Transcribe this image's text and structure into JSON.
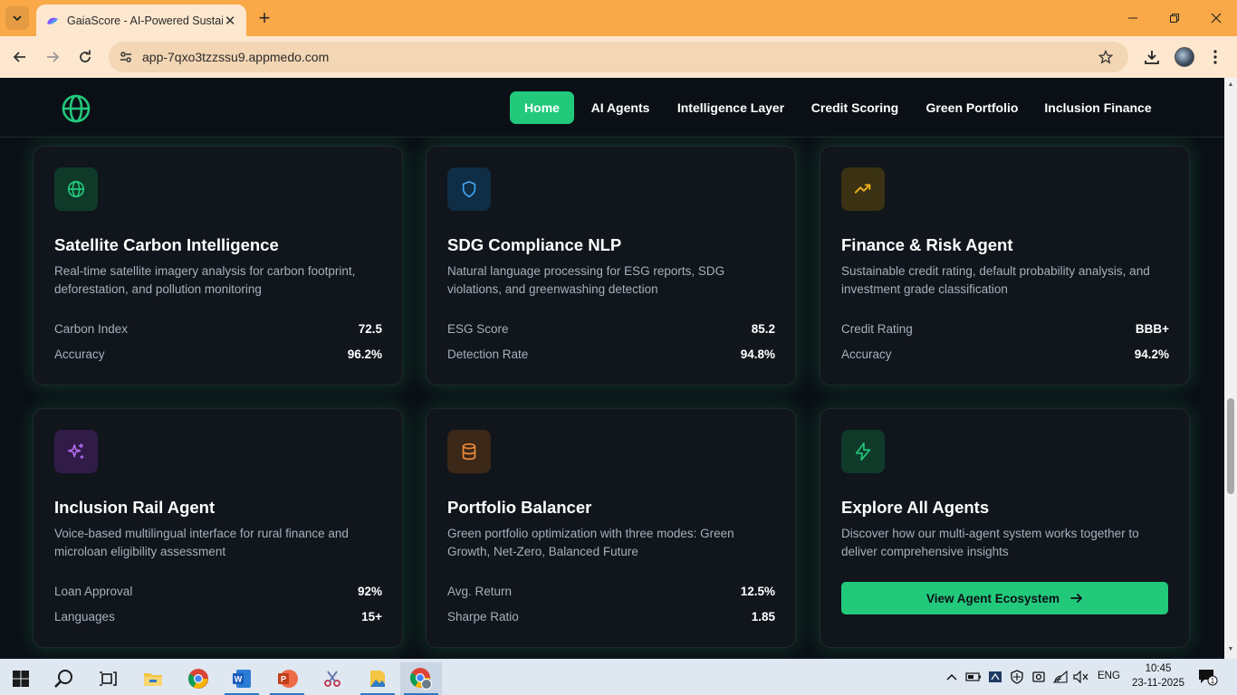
{
  "browser": {
    "tab_title": "GaiaScore - AI-Powered Sustain",
    "url": "app-7qxo3tzzssu9.appmedo.com"
  },
  "nav": {
    "items": [
      "Home",
      "AI Agents",
      "Intelligence Layer",
      "Credit Scoring",
      "Green Portfolio",
      "Inclusion Finance"
    ],
    "active": "Home"
  },
  "cards": [
    {
      "icon": "globe-icon",
      "title": "Satellite Carbon Intelligence",
      "description": "Real-time satellite imagery analysis for carbon footprint, deforestation, and pollution monitoring",
      "metrics": [
        {
          "label": "Carbon Index",
          "value": "72.5"
        },
        {
          "label": "Accuracy",
          "value": "96.2%"
        }
      ]
    },
    {
      "icon": "shield-icon",
      "title": "SDG Compliance NLP",
      "description": "Natural language processing for ESG reports, SDG violations, and greenwashing detection",
      "metrics": [
        {
          "label": "ESG Score",
          "value": "85.2"
        },
        {
          "label": "Detection Rate",
          "value": "94.8%"
        }
      ]
    },
    {
      "icon": "trending-up-icon",
      "title": "Finance & Risk Agent",
      "description": "Sustainable credit rating, default probability analysis, and investment grade classification",
      "metrics": [
        {
          "label": "Credit Rating",
          "value": "BBB+"
        },
        {
          "label": "Accuracy",
          "value": "94.2%"
        }
      ]
    },
    {
      "icon": "sparkles-icon",
      "title": "Inclusion Rail Agent",
      "description": "Voice-based multilingual interface for rural finance and microloan eligibility assessment",
      "metrics": [
        {
          "label": "Loan Approval",
          "value": "92%"
        },
        {
          "label": "Languages",
          "value": "15+"
        }
      ]
    },
    {
      "icon": "database-icon",
      "title": "Portfolio Balancer",
      "description": "Green portfolio optimization with three modes: Green Growth, Net-Zero, Balanced Future",
      "metrics": [
        {
          "label": "Avg. Return",
          "value": "12.5%"
        },
        {
          "label": "Sharpe Ratio",
          "value": "1.85"
        }
      ]
    },
    {
      "icon": "lightning-icon",
      "title": "Explore All Agents",
      "description": "Discover how our multi-agent system works together to deliver comprehensive insights",
      "button_label": "View Agent Ecosystem"
    }
  ],
  "colors": {
    "accent": "#22c97b",
    "background": "#0b1016",
    "card": "#11151c",
    "browser_frame": "#f9a947"
  },
  "taskbar": {
    "language": "ENG",
    "time": "10:45",
    "date": "23-11-2025",
    "notification_count": "1"
  }
}
